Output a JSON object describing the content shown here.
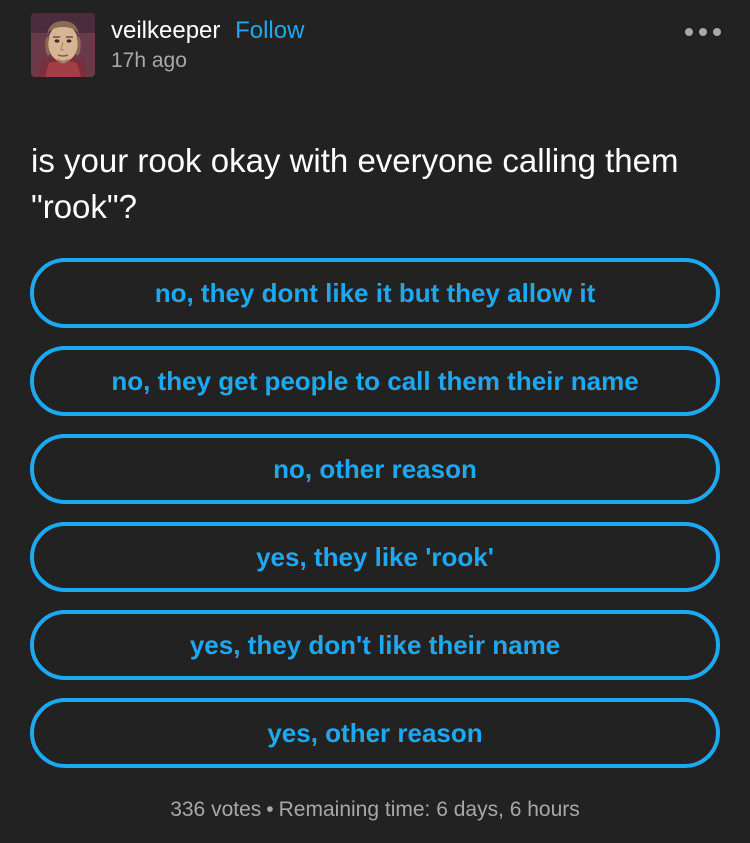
{
  "post": {
    "author": "veilkeeper",
    "follow_label": "Follow",
    "timestamp": "17h ago",
    "avatar_icon": "character-portrait-avatar",
    "menu_icon": "more-options-icon"
  },
  "poll": {
    "question": "is your rook okay with everyone calling them \"rook\"?",
    "options": [
      "no, they dont like it but they allow it",
      "no, they get people to call them their name",
      "no, other reason",
      "yes, they like 'rook'",
      "yes, they don't like their name",
      "yes, other reason"
    ],
    "votes": "336 votes",
    "separator": "•",
    "remaining": "Remaining time: 6 days, 6 hours"
  },
  "colors": {
    "background": "#222222",
    "accent": "#1ea8f0",
    "muted_text": "#a8a8a8",
    "text": "#ffffff"
  }
}
